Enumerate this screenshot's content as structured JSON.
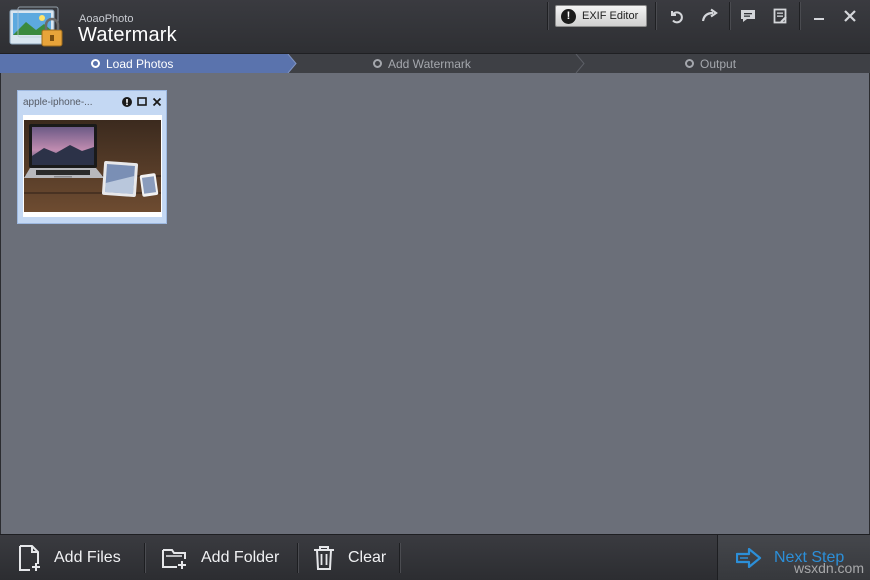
{
  "app": {
    "brand_small": "AoaoPhoto",
    "brand_big": "Watermark"
  },
  "toolbar": {
    "exif_label": "EXIF Editor"
  },
  "steps": [
    {
      "label": "Load Photos",
      "active": true
    },
    {
      "label": "Add Watermark",
      "active": false
    },
    {
      "label": "Output",
      "active": false
    }
  ],
  "photos": [
    {
      "name": "apple-iphone-..."
    }
  ],
  "bottom": {
    "add_files": "Add Files",
    "add_folder": "Add Folder",
    "clear": "Clear",
    "next_step": "Next Step"
  },
  "watermark": "wsxdn.com",
  "colors": {
    "accent": "#2c8fd8",
    "active_step": "#5a73ad",
    "workspace": "#6b6f79"
  }
}
